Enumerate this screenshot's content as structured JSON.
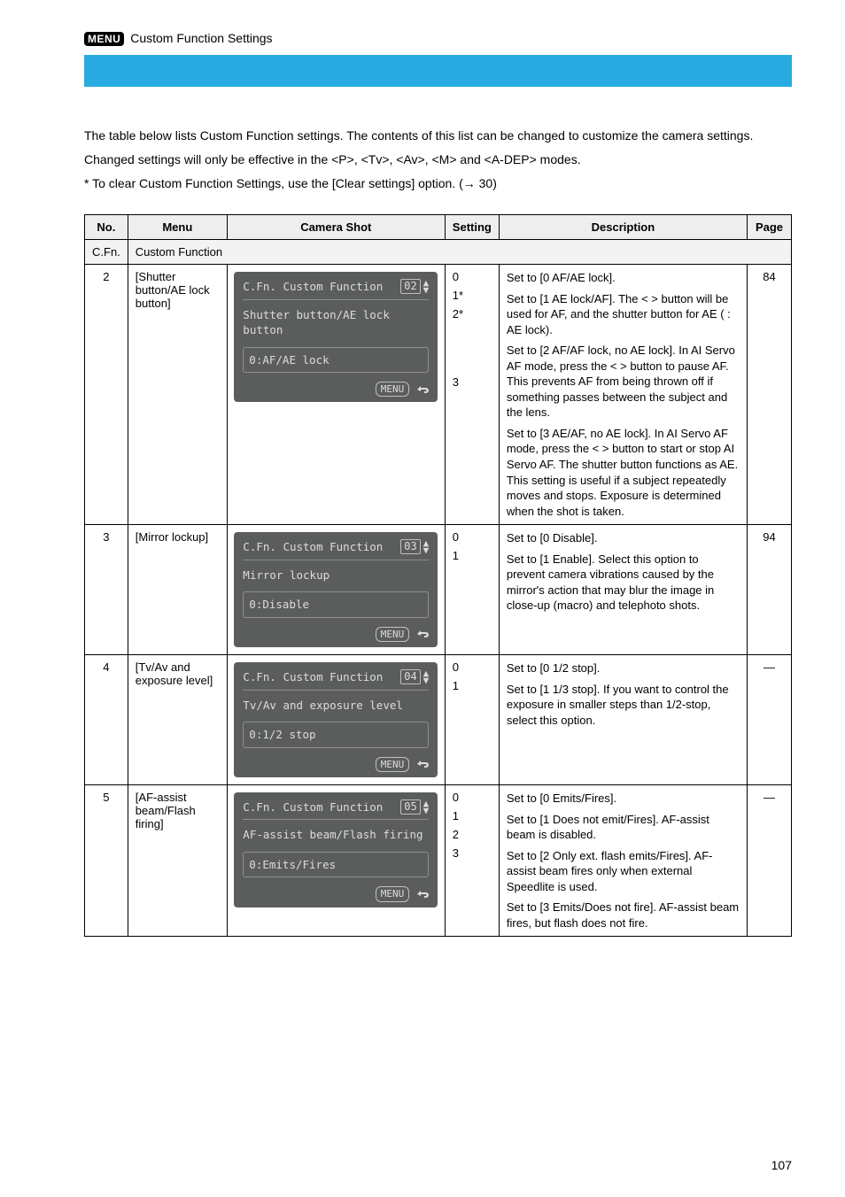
{
  "top_menu_label": "MENU",
  "menu_suffix": "Custom Function Settings",
  "intro": {
    "p1": "The table below lists Custom Function settings. The contents of this list can be changed to customize the camera settings.",
    "p2": "Changed settings will only be effective in the <P>, <Tv>, <Av>, <M> and <A-DEP> modes.",
    "note": "* To clear Custom Function Settings, use the [Clear settings] option. (→ 30)"
  },
  "headers": {
    "no": "No.",
    "menu": "Menu",
    "shot": "Camera Shot",
    "set": "Setting",
    "desc": "Description",
    "page": "Page"
  },
  "subheads": [
    "C.Fn.",
    "Custom Function"
  ],
  "shot_title": "C.Fn. Custom Function",
  "shot_menu_foot": "MENU",
  "rows": [
    {
      "no": "2",
      "menu": "[Shutter button/AE lock button]",
      "shot_num": "02",
      "shot_line2": "Shutter button/AE lock button",
      "shot_value": "0:AF/AE lock",
      "settings": [
        "0",
        "1*",
        "2*",
        "3"
      ],
      "desc": [
        "Set to [0 AF/AE lock].",
        "Set to [1 AE lock/AF]. The <   > button will be used for AF, and the shutter button for AE (   : AE lock).",
        "Set to [2 AF/AF lock, no AE lock]. In AI Servo AF mode, press the <   > button to pause AF. This prevents AF from being thrown off if something passes between the subject and the lens.",
        "Set to [3 AE/AF, no AE lock]. In AI Servo AF mode, press the <   > button to start or stop AI Servo AF. The shutter button functions as AE. This setting is useful if a subject repeatedly moves and stops. Exposure is determined when the shot is taken."
      ],
      "page": "84"
    },
    {
      "no": "3",
      "menu": "[Mirror lockup]",
      "shot_num": "03",
      "shot_line2": "Mirror lockup",
      "shot_value": "0:Disable",
      "settings": [
        "0",
        "1"
      ],
      "desc": [
        "Set to [0 Disable].",
        "Set to [1 Enable]. Select this option to prevent camera vibrations caused by the mirror's action that may blur the image in close-up (macro) and telephoto shots."
      ],
      "page": "94"
    },
    {
      "no": "4",
      "menu": "[Tv/Av and exposure level]",
      "shot_num": "04",
      "shot_line2": "Tv/Av and exposure level",
      "shot_value": "0:1/2 stop",
      "settings": [
        "0",
        "1"
      ],
      "desc": [
        "Set to [0 1/2 stop].",
        "Set to [1 1/3 stop]. If you want to control the exposure in smaller steps than 1/2-stop, select this option."
      ],
      "page": "—"
    },
    {
      "no": "5",
      "menu": "[AF-assist beam/Flash firing]",
      "shot_num": "05",
      "shot_line2": "AF-assist beam/Flash firing",
      "shot_value": "0:Emits/Fires",
      "settings": [
        "0",
        "1",
        "2",
        "3"
      ],
      "desc": [
        "Set to [0 Emits/Fires].",
        "Set to [1 Does not emit/Fires]. AF-assist beam is disabled.",
        "Set to [2 Only ext. flash emits/Fires]. AF-assist beam fires only when external Speedlite is used.",
        "Set to [3 Emits/Does not fire]. AF-assist beam fires, but flash does not fire."
      ],
      "page": "—"
    }
  ],
  "page_number": "107"
}
